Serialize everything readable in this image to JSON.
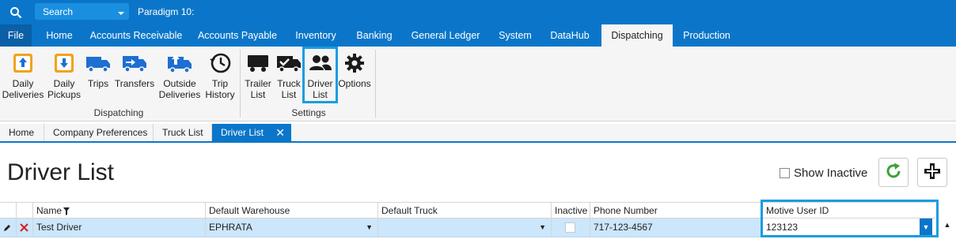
{
  "titlebar": {
    "search_placeholder": "Search",
    "app_title": "Paradigm 10:"
  },
  "menu": {
    "items": [
      "File",
      "Home",
      "Accounts Receivable",
      "Accounts Payable",
      "Inventory",
      "Banking",
      "General Ledger",
      "System",
      "DataHub",
      "Dispatching",
      "Production"
    ],
    "active": "Dispatching"
  },
  "ribbon": {
    "dispatching": {
      "group_label": "Dispatching",
      "buttons": [
        {
          "line1": "Daily",
          "line2": "Deliveries",
          "icon": "daily-deliveries-icon"
        },
        {
          "line1": "Daily",
          "line2": "Pickups",
          "icon": "daily-pickups-icon"
        },
        {
          "line1": "Trips",
          "line2": "",
          "icon": "truck-icon"
        },
        {
          "line1": "Transfers",
          "line2": "",
          "icon": "transfer-truck-icon"
        },
        {
          "line1": "Outside",
          "line2": "Deliveries",
          "icon": "outside-deliveries-icon"
        },
        {
          "line1": "Trip",
          "line2": "History",
          "icon": "history-clock-icon"
        }
      ]
    },
    "settings": {
      "group_label": "Settings",
      "buttons": [
        {
          "line1": "Trailer",
          "line2": "List",
          "icon": "trailer-icon"
        },
        {
          "line1": "Truck",
          "line2": "List",
          "icon": "truck-check-icon"
        },
        {
          "line1": "Driver",
          "line2": "List",
          "icon": "people-icon"
        },
        {
          "line1": "Options",
          "line2": "",
          "icon": "gear-icon"
        }
      ]
    }
  },
  "doc_tabs": {
    "items": [
      "Home",
      "Company Preferences",
      "Truck List",
      "Driver List"
    ],
    "active": "Driver List",
    "close_glyph": "✕"
  },
  "page": {
    "title": "Driver List",
    "show_inactive_label": "Show Inactive",
    "show_inactive_checked": false
  },
  "grid": {
    "columns": [
      "Name",
      "Default Warehouse",
      "Default Truck",
      "Inactive",
      "Phone Number",
      "Motive User ID"
    ],
    "rows": [
      {
        "name": "Test Driver",
        "default_warehouse": "EPHRATA",
        "default_truck": "",
        "inactive": false,
        "phone_number": "717-123-4567",
        "motive_user_id": "123123"
      }
    ]
  },
  "colors": {
    "brand_blue": "#0b76c9",
    "highlight_blue": "#1a9de0",
    "selected_row": "#cce6fb",
    "refresh_green": "#3da13a",
    "delete_red": "#d21f1f"
  }
}
